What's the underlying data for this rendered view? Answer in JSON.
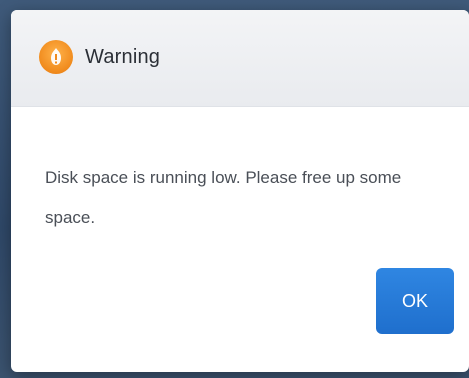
{
  "dialog": {
    "title": "Warning",
    "icon": "warning-icon",
    "message": "Disk space is running low. Please free up some space.",
    "ok_label": "OK"
  },
  "colors": {
    "accent": "#1f6fcd",
    "warning": "#f08a1c",
    "backdrop": "#2f4868"
  }
}
